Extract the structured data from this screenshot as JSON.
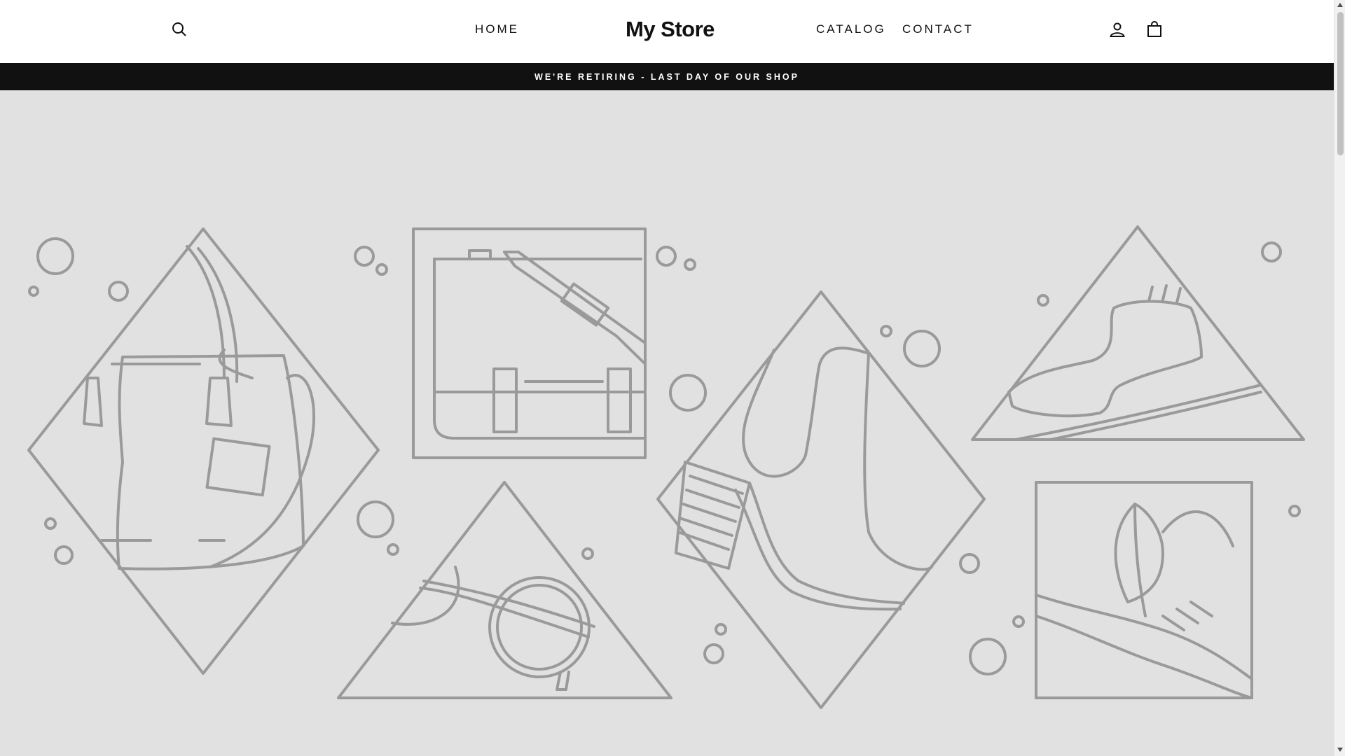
{
  "header": {
    "logo": "My Store",
    "nav": {
      "home": "HOME",
      "catalog": "CATALOG",
      "contact": "CONTACT"
    },
    "icons": {
      "search": "search-icon",
      "account": "user-icon",
      "cart": "shopping-bag-icon"
    }
  },
  "announcement": {
    "text": "WE'RE RETIRING - LAST DAY OF OUR SHOP"
  },
  "hero": {
    "illustration": [
      "handbag-icon",
      "messenger-bag-icon",
      "sunglasses-icon",
      "boot-icon",
      "brogue-shoe-icon",
      "hat-feather-icon"
    ]
  },
  "colors": {
    "header_bg": "#ffffff",
    "announcement_bg": "#111111",
    "hero_bg": "#e1e1e1",
    "line_art": "#9a9a9a",
    "text": "#111111"
  }
}
